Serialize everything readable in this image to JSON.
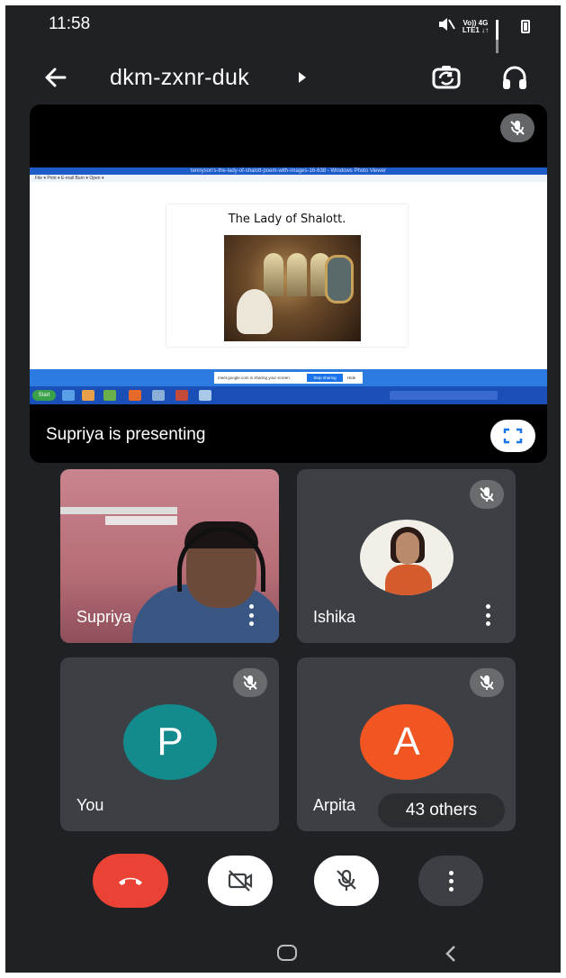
{
  "status_bar": {
    "time": "11:58",
    "network_line1": "Vo)) 4G",
    "network_line2": "LTE1 ↓↑",
    "icons": [
      "mute-icon",
      "signal-icon",
      "battery-icon"
    ]
  },
  "header": {
    "meeting_code": "dkm-zxnr-duk",
    "icons": [
      "back-arrow-icon",
      "caret-right-icon",
      "switch-camera-icon",
      "headphones-icon"
    ]
  },
  "presentation": {
    "screen_window_title": "tennyson's-the-lady-of-shalott-poem-with-images-16-638 - Windows Photo Viewer",
    "screen_menu": "File ▾   Print ▾   E-mail   Burn ▾   Open ▾",
    "slide_title": "The Lady of Shalott.",
    "share_bar_text": "meet.google.com is sharing your screen.",
    "share_stop_label": "Stop sharing",
    "share_hide_label": "Hide",
    "taskbar_start": "Start",
    "presenting_label": "Supriya is presenting"
  },
  "participants": [
    {
      "name": "Supriya",
      "muted": false,
      "type": "video"
    },
    {
      "name": "Ishika",
      "muted": true,
      "type": "photo"
    },
    {
      "name": "You",
      "muted": true,
      "type": "letter",
      "letter": "P",
      "color": "#138a8c"
    },
    {
      "name": "Arpita",
      "muted": true,
      "type": "letter",
      "letter": "A",
      "color": "#f15522"
    }
  ],
  "others_chip": "43 others",
  "controls": {
    "end_call": "end-call-icon",
    "camera": "camera-off-icon",
    "mic": "mic-off-icon",
    "more": "more-options-icon"
  },
  "colors": {
    "background": "#1f2124",
    "tile": "#3c3f43",
    "end_call": "#ea4335"
  }
}
